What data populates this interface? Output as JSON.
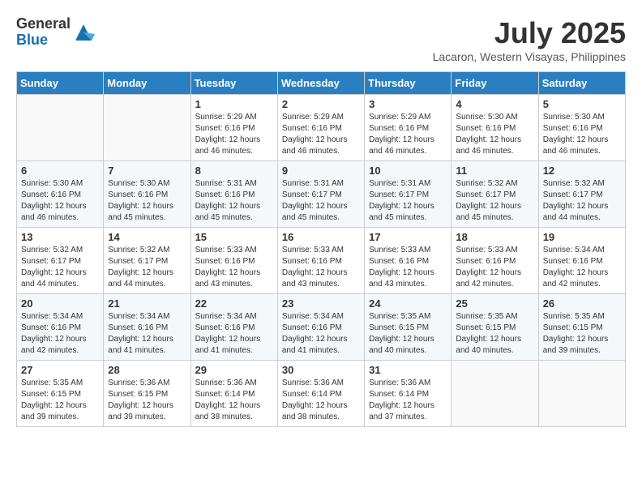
{
  "header": {
    "logo_general": "General",
    "logo_blue": "Blue",
    "month_title": "July 2025",
    "subtitle": "Lacaron, Western Visayas, Philippines"
  },
  "days_of_week": [
    "Sunday",
    "Monday",
    "Tuesday",
    "Wednesday",
    "Thursday",
    "Friday",
    "Saturday"
  ],
  "weeks": [
    [
      {
        "day": "",
        "info": ""
      },
      {
        "day": "",
        "info": ""
      },
      {
        "day": "1",
        "info": "Sunrise: 5:29 AM\nSunset: 6:16 PM\nDaylight: 12 hours and 46 minutes."
      },
      {
        "day": "2",
        "info": "Sunrise: 5:29 AM\nSunset: 6:16 PM\nDaylight: 12 hours and 46 minutes."
      },
      {
        "day": "3",
        "info": "Sunrise: 5:29 AM\nSunset: 6:16 PM\nDaylight: 12 hours and 46 minutes."
      },
      {
        "day": "4",
        "info": "Sunrise: 5:30 AM\nSunset: 6:16 PM\nDaylight: 12 hours and 46 minutes."
      },
      {
        "day": "5",
        "info": "Sunrise: 5:30 AM\nSunset: 6:16 PM\nDaylight: 12 hours and 46 minutes."
      }
    ],
    [
      {
        "day": "6",
        "info": "Sunrise: 5:30 AM\nSunset: 6:16 PM\nDaylight: 12 hours and 46 minutes."
      },
      {
        "day": "7",
        "info": "Sunrise: 5:30 AM\nSunset: 6:16 PM\nDaylight: 12 hours and 45 minutes."
      },
      {
        "day": "8",
        "info": "Sunrise: 5:31 AM\nSunset: 6:16 PM\nDaylight: 12 hours and 45 minutes."
      },
      {
        "day": "9",
        "info": "Sunrise: 5:31 AM\nSunset: 6:17 PM\nDaylight: 12 hours and 45 minutes."
      },
      {
        "day": "10",
        "info": "Sunrise: 5:31 AM\nSunset: 6:17 PM\nDaylight: 12 hours and 45 minutes."
      },
      {
        "day": "11",
        "info": "Sunrise: 5:32 AM\nSunset: 6:17 PM\nDaylight: 12 hours and 45 minutes."
      },
      {
        "day": "12",
        "info": "Sunrise: 5:32 AM\nSunset: 6:17 PM\nDaylight: 12 hours and 44 minutes."
      }
    ],
    [
      {
        "day": "13",
        "info": "Sunrise: 5:32 AM\nSunset: 6:17 PM\nDaylight: 12 hours and 44 minutes."
      },
      {
        "day": "14",
        "info": "Sunrise: 5:32 AM\nSunset: 6:17 PM\nDaylight: 12 hours and 44 minutes."
      },
      {
        "day": "15",
        "info": "Sunrise: 5:33 AM\nSunset: 6:16 PM\nDaylight: 12 hours and 43 minutes."
      },
      {
        "day": "16",
        "info": "Sunrise: 5:33 AM\nSunset: 6:16 PM\nDaylight: 12 hours and 43 minutes."
      },
      {
        "day": "17",
        "info": "Sunrise: 5:33 AM\nSunset: 6:16 PM\nDaylight: 12 hours and 43 minutes."
      },
      {
        "day": "18",
        "info": "Sunrise: 5:33 AM\nSunset: 6:16 PM\nDaylight: 12 hours and 42 minutes."
      },
      {
        "day": "19",
        "info": "Sunrise: 5:34 AM\nSunset: 6:16 PM\nDaylight: 12 hours and 42 minutes."
      }
    ],
    [
      {
        "day": "20",
        "info": "Sunrise: 5:34 AM\nSunset: 6:16 PM\nDaylight: 12 hours and 42 minutes."
      },
      {
        "day": "21",
        "info": "Sunrise: 5:34 AM\nSunset: 6:16 PM\nDaylight: 12 hours and 41 minutes."
      },
      {
        "day": "22",
        "info": "Sunrise: 5:34 AM\nSunset: 6:16 PM\nDaylight: 12 hours and 41 minutes."
      },
      {
        "day": "23",
        "info": "Sunrise: 5:34 AM\nSunset: 6:16 PM\nDaylight: 12 hours and 41 minutes."
      },
      {
        "day": "24",
        "info": "Sunrise: 5:35 AM\nSunset: 6:15 PM\nDaylight: 12 hours and 40 minutes."
      },
      {
        "day": "25",
        "info": "Sunrise: 5:35 AM\nSunset: 6:15 PM\nDaylight: 12 hours and 40 minutes."
      },
      {
        "day": "26",
        "info": "Sunrise: 5:35 AM\nSunset: 6:15 PM\nDaylight: 12 hours and 39 minutes."
      }
    ],
    [
      {
        "day": "27",
        "info": "Sunrise: 5:35 AM\nSunset: 6:15 PM\nDaylight: 12 hours and 39 minutes."
      },
      {
        "day": "28",
        "info": "Sunrise: 5:36 AM\nSunset: 6:15 PM\nDaylight: 12 hours and 39 minutes."
      },
      {
        "day": "29",
        "info": "Sunrise: 5:36 AM\nSunset: 6:14 PM\nDaylight: 12 hours and 38 minutes."
      },
      {
        "day": "30",
        "info": "Sunrise: 5:36 AM\nSunset: 6:14 PM\nDaylight: 12 hours and 38 minutes."
      },
      {
        "day": "31",
        "info": "Sunrise: 5:36 AM\nSunset: 6:14 PM\nDaylight: 12 hours and 37 minutes."
      },
      {
        "day": "",
        "info": ""
      },
      {
        "day": "",
        "info": ""
      }
    ]
  ]
}
